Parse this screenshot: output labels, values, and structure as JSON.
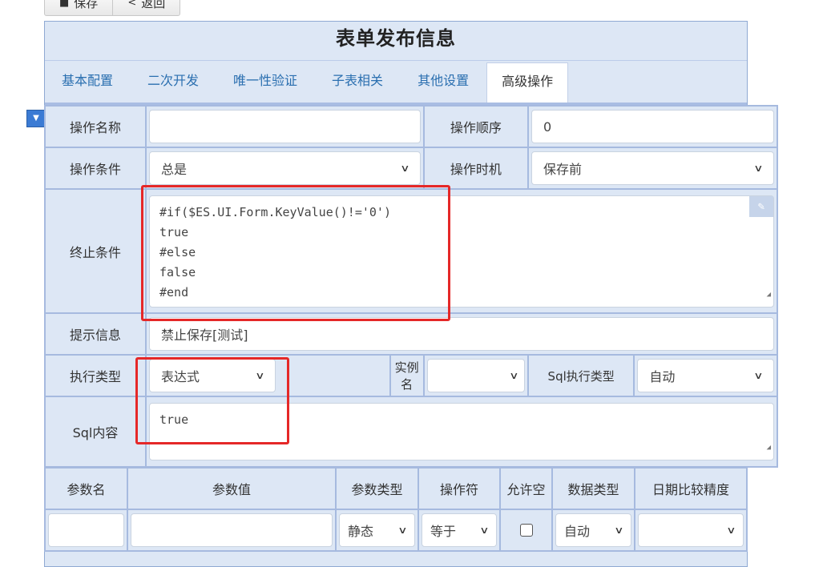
{
  "toolbar": {
    "save_label": "保存",
    "back_label": "返回"
  },
  "form_title": "表单发布信息",
  "tabs": [
    "基本配置",
    "二次开发",
    "唯一性验证",
    "子表相关",
    "其他设置",
    "高级操作"
  ],
  "fields": {
    "op_name_label": "操作名称",
    "op_name_value": "",
    "op_order_label": "操作顺序",
    "op_order_value": "0",
    "op_cond_label": "操作条件",
    "op_cond_value": "总是",
    "op_time_label": "操作时机",
    "op_time_value": "保存前",
    "stop_cond_label": "终止条件",
    "stop_cond_lines": [
      "#if($ES.UI.Form.KeyValue()!='0')",
      "true",
      "#else",
      "false",
      "#end"
    ],
    "tip_label": "提示信息",
    "tip_value": "禁止保存[测试]",
    "exec_type_label": "执行类型",
    "exec_type_value": "表达式",
    "instance_label": "实例名",
    "instance_value": "",
    "sql_exec_type_label": "Sql执行类型",
    "sql_exec_type_value": "自动",
    "sql_content_label": "Sql内容",
    "sql_content_value": "true"
  },
  "params": {
    "headers": [
      "参数名",
      "参数值",
      "参数类型",
      "操作符",
      "允许空",
      "数据类型",
      "日期比较精度"
    ],
    "row": {
      "name": "",
      "value": "",
      "type": "静态",
      "operator": "等于",
      "allow_null": false,
      "data_type": "自动",
      "precision": ""
    }
  },
  "colors": {
    "highlight": "#e52828",
    "tab_link": "#2a6fb0",
    "panel_bg": "#dde7f5",
    "border": "#a6badf"
  }
}
